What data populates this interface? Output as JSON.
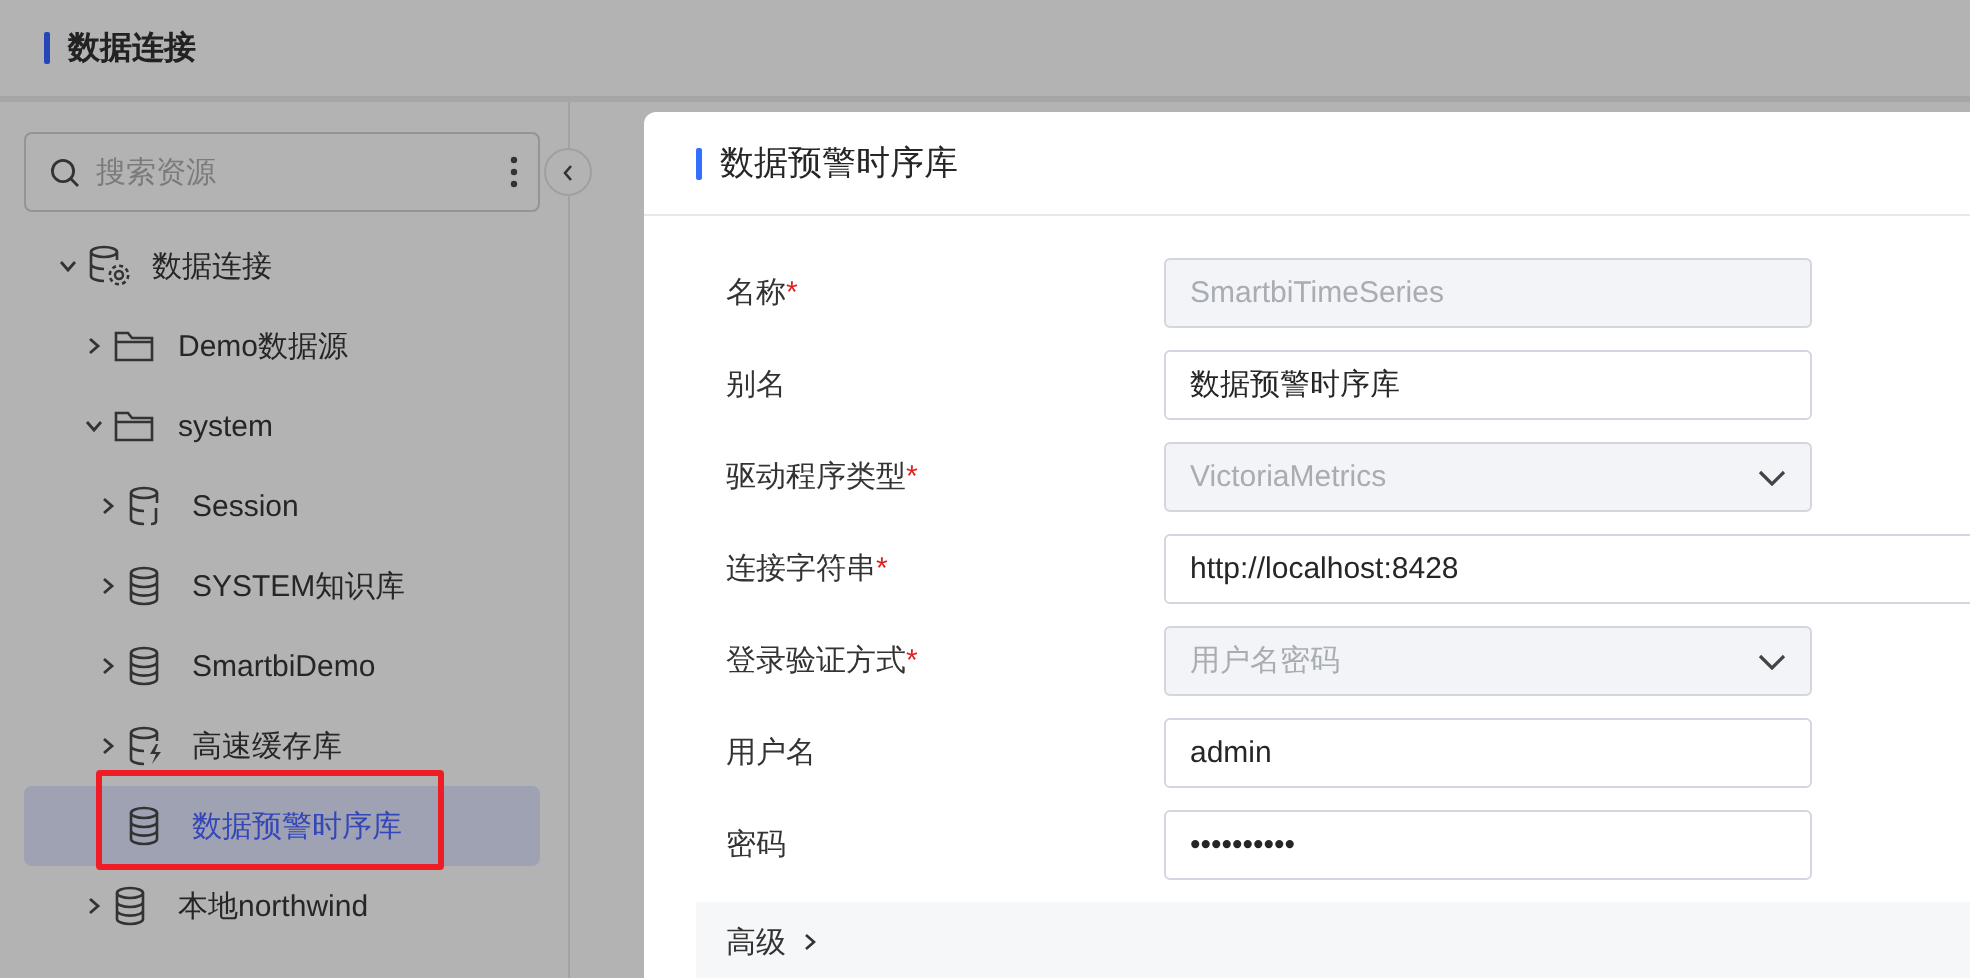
{
  "header": {
    "title": "数据连接"
  },
  "sidebar": {
    "search": {
      "placeholder": "搜索资源"
    },
    "tree": [
      {
        "label": "数据连接",
        "kind": "root",
        "expanded": true,
        "selected": false,
        "children": [
          {
            "label": "Demo数据源",
            "kind": "folder",
            "expanded": false,
            "selected": false
          },
          {
            "label": "system",
            "kind": "folder",
            "expanded": true,
            "selected": false,
            "children": [
              {
                "label": "Session",
                "kind": "session",
                "expanded": false,
                "selected": false
              },
              {
                "label": "SYSTEM知识库",
                "kind": "db",
                "expanded": false,
                "selected": false
              },
              {
                "label": "SmartbiDemo",
                "kind": "db",
                "expanded": false,
                "selected": false
              },
              {
                "label": "高速缓存库",
                "kind": "cache",
                "expanded": false,
                "selected": false
              },
              {
                "label": "数据预警时序库",
                "kind": "db",
                "selected": true,
                "highlighted": true
              }
            ]
          },
          {
            "label": "本地northwind",
            "kind": "db",
            "expanded": false,
            "selected": false
          }
        ]
      }
    ]
  },
  "dialog": {
    "title": "数据预警时序库",
    "fields": [
      {
        "label": "名称",
        "required_mark": "*",
        "kind": "input",
        "disabled": true,
        "value": "SmartbiTimeSeries",
        "wide": false
      },
      {
        "label": "别名",
        "kind": "input",
        "disabled": false,
        "value": "数据预警时序库",
        "wide": false
      },
      {
        "label": "驱动程序类型",
        "required_mark": "*",
        "kind": "select",
        "disabled": true,
        "value": "VictoriaMetrics",
        "wide": false
      },
      {
        "label": "连接字符串",
        "required_mark": "*",
        "kind": "input",
        "disabled": false,
        "value": "http://localhost:8428",
        "wide": true
      },
      {
        "label": "登录验证方式",
        "required_mark": "*",
        "kind": "select",
        "disabled": true,
        "value": "用户名密码",
        "wide": false
      },
      {
        "label": "用户名",
        "kind": "input",
        "disabled": false,
        "value": "admin",
        "wide": false
      },
      {
        "label": "密码",
        "kind": "password",
        "disabled": false,
        "value": "••••••••••",
        "wide": false
      }
    ],
    "advanced": {
      "label": "高级",
      "expanded": false
    }
  }
}
